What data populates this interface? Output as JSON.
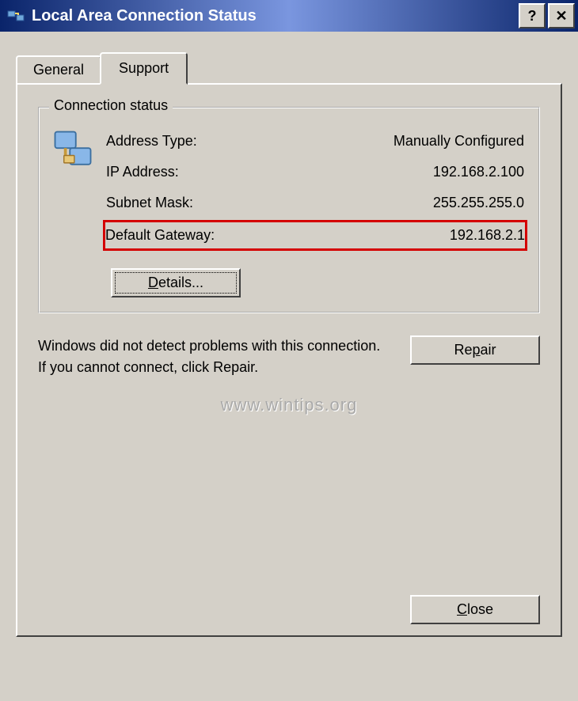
{
  "titlebar": {
    "title": "Local Area Connection Status",
    "help_symbol": "?",
    "close_symbol": "✕"
  },
  "tabs": {
    "general": "General",
    "support": "Support"
  },
  "group": {
    "title": "Connection status",
    "rows": {
      "address_type_label": "Address Type:",
      "address_type_value": "Manually Configured",
      "ip_label": "IP Address:",
      "ip_value": "192.168.2.100",
      "mask_label": "Subnet Mask:",
      "mask_value": "255.255.255.0",
      "gateway_label": "Default Gateway:",
      "gateway_value": "192.168.2.1"
    },
    "details_button": "Details..."
  },
  "help_text": "Windows did not detect problems with this connection. If you cannot connect, click Repair.",
  "repair_button": "Repair",
  "close_button": "Close",
  "watermark": "www.wintips.org"
}
